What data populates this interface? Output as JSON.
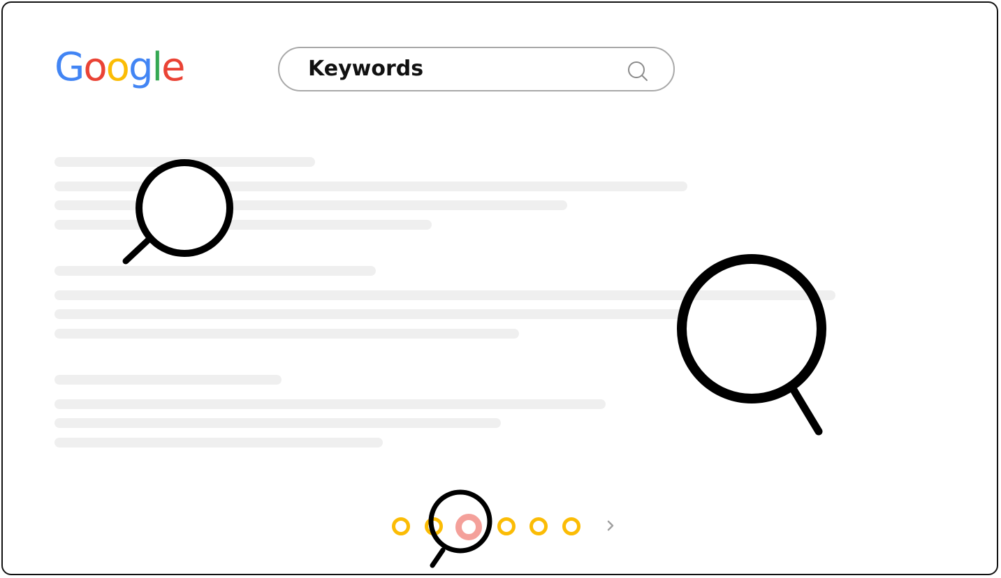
{
  "header": {
    "logo_letters": [
      {
        "char": "G",
        "color": "#4285F4"
      },
      {
        "char": "o",
        "color": "#EA4335"
      },
      {
        "char": "o",
        "color": "#FBBC05"
      },
      {
        "char": "g",
        "color": "#4285F4"
      },
      {
        "char": "l",
        "color": "#34A853"
      },
      {
        "char": "e",
        "color": "#EA4335"
      }
    ],
    "logo_alt": "Google"
  },
  "search": {
    "query": "Keywords",
    "icon": "search-icon",
    "border_color": "#a8a8a8"
  },
  "results": {
    "placeholder_color": "#efefef",
    "groups": 3
  },
  "pagination": {
    "dot_color": "#FBBC05",
    "active_color": "#F4A09A",
    "pages": 6,
    "active_index": 2,
    "next_icon": "chevron-right-icon"
  },
  "decorations": {
    "icon": "magnifier-icon",
    "count": 3,
    "stroke_color": "#000000"
  },
  "frame": {
    "border_color": "#111111",
    "background": "#ffffff"
  }
}
